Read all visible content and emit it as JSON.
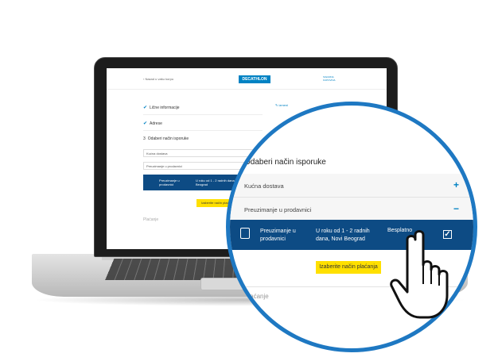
{
  "screen": {
    "back_link": "‹ Nazad u vašu korpu",
    "logo": "DECATHLON",
    "secure_label": "SIGURNA KUPOVINA",
    "steps": [
      {
        "label": "Lične informacije"
      },
      {
        "label": "Adrese"
      },
      {
        "label": "Odaberi način isporuke"
      }
    ],
    "edit_label": "✎ izmeni",
    "home_delivery": "Kućna dostava",
    "store_pickup": "Preuzimanje u prodavnici",
    "selected_option": {
      "name": "Preuzimanje u prodavnici",
      "time": "U roku od 1 - 2 radnih dana, Novi Beograd",
      "price": "Besplatno"
    },
    "button": "Izaberite način plaćanja",
    "payment": "Plaćanje"
  },
  "magnified": {
    "title": "Odaberi način isporuke",
    "home_delivery": "Kućna dostava",
    "home_sign": "+",
    "store_pickup": "Preuzimanje u prodavnici",
    "store_sign": "−",
    "selected": {
      "name": "Preuzimanje u prodavnici",
      "time": "U roku od 1 - 2 radnih dana, Novi Beograd",
      "price": "Besplatno"
    },
    "button": "Izaberite način plaćanja",
    "payment": "Plaćanje"
  },
  "colors": {
    "accent": "#0082c3",
    "selected_bg": "#0d4b84",
    "button_bg": "#ffe000",
    "ring": "#1e78c2"
  },
  "icons": [
    "check-icon",
    "store-icon",
    "checkbox-icon",
    "hand-pointer-icon"
  ]
}
